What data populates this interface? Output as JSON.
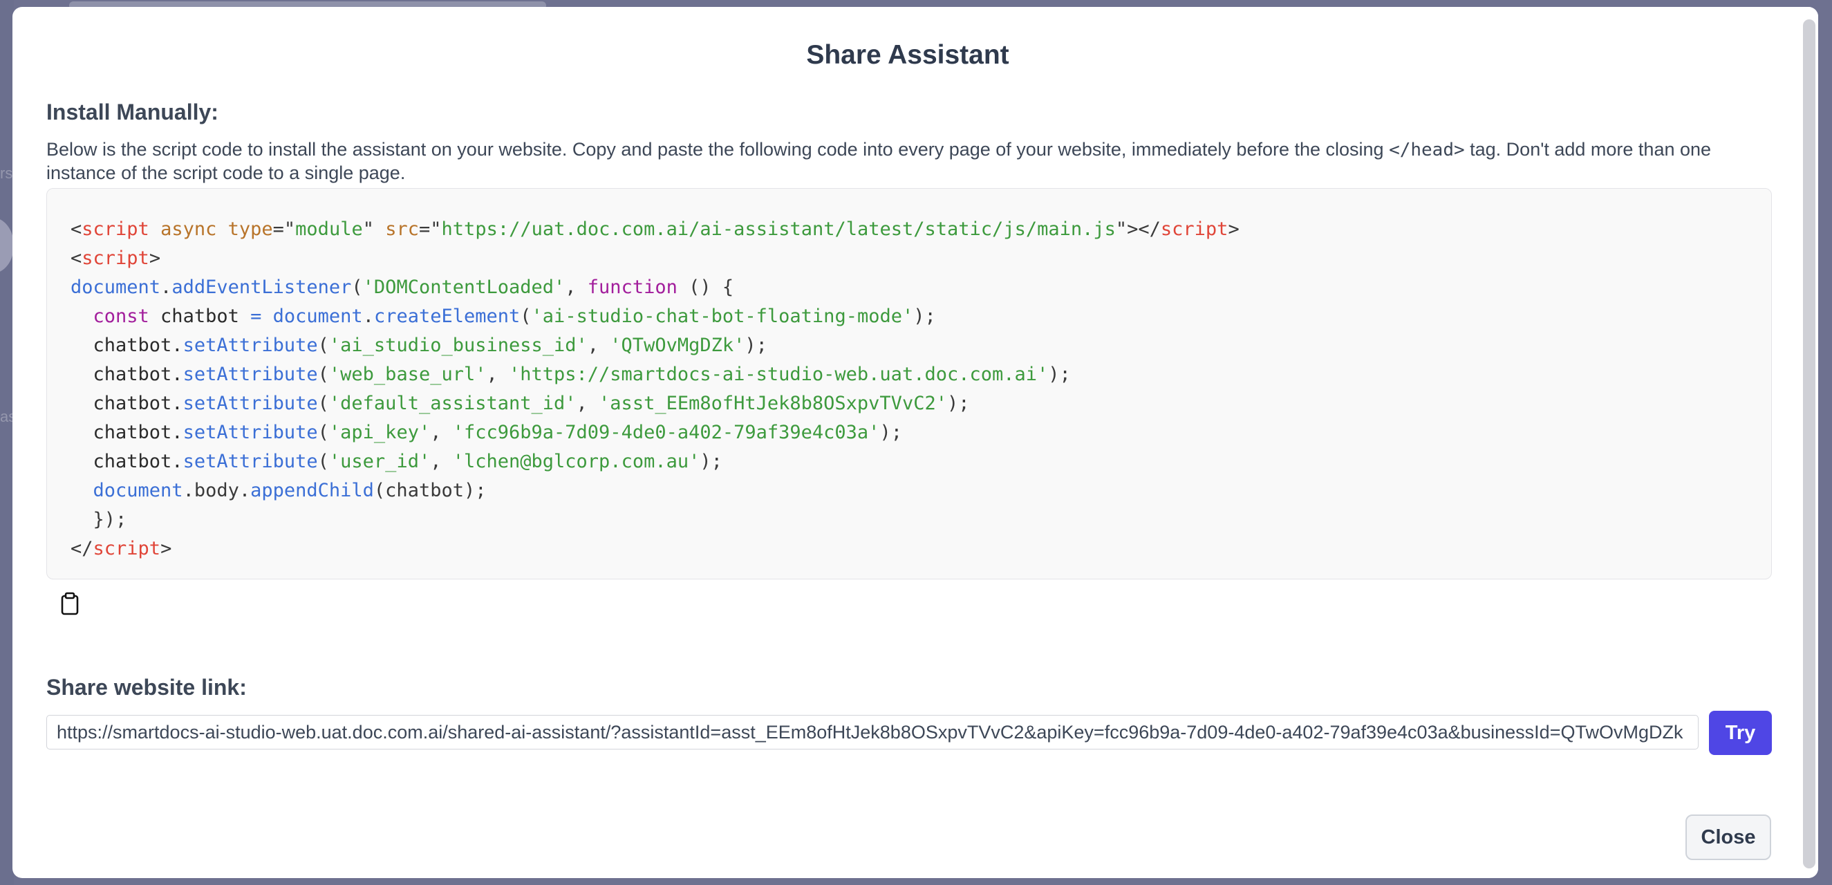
{
  "backdrop": {
    "left_glyph_1": "rs",
    "left_glyph_2": "as"
  },
  "modal": {
    "title": "Share Assistant",
    "install_section": {
      "title": "Install Manually:",
      "description_before": "Below is the script code to install the assistant on your website. Copy and paste the following code into every page of your website, immediately before the closing ",
      "description_tag": "</head>",
      "description_after": " tag. Don't add more than one instance of the script code to a single page."
    },
    "code_lines": [
      [
        [
          "punct",
          "<"
        ],
        [
          "tag",
          "script"
        ],
        [
          "plain",
          " "
        ],
        [
          "attr",
          "async"
        ],
        [
          "plain",
          " "
        ],
        [
          "attr",
          "type"
        ],
        [
          "punct",
          "=\""
        ],
        [
          "str",
          "module"
        ],
        [
          "punct",
          "\""
        ],
        [
          "plain",
          " "
        ],
        [
          "attr",
          "src"
        ],
        [
          "punct",
          "=\""
        ],
        [
          "str",
          "https://uat.doc.com.ai/ai-assistant/latest/static/js/main.js"
        ],
        [
          "punct",
          "\"></"
        ],
        [
          "tag",
          "script"
        ],
        [
          "punct",
          ">"
        ]
      ],
      [
        [
          "punct",
          "<"
        ],
        [
          "tag",
          "script"
        ],
        [
          "punct",
          ">"
        ]
      ],
      [
        [
          "obj",
          "document"
        ],
        [
          "punct",
          "."
        ],
        [
          "fn",
          "addEventListener"
        ],
        [
          "punct",
          "("
        ],
        [
          "str",
          "'DOMContentLoaded'"
        ],
        [
          "punct",
          ", "
        ],
        [
          "kw",
          "function"
        ],
        [
          "punct",
          " () {"
        ]
      ],
      [
        [
          "plain",
          "  "
        ],
        [
          "kw",
          "const"
        ],
        [
          "plain",
          " chatbot "
        ],
        [
          "op",
          "="
        ],
        [
          "plain",
          " "
        ],
        [
          "obj",
          "document"
        ],
        [
          "punct",
          "."
        ],
        [
          "fn",
          "createElement"
        ],
        [
          "punct",
          "("
        ],
        [
          "str",
          "'ai-studio-chat-bot-floating-mode'"
        ],
        [
          "punct",
          ");"
        ]
      ],
      [
        [
          "plain",
          "  chatbot."
        ],
        [
          "fn",
          "setAttribute"
        ],
        [
          "punct",
          "("
        ],
        [
          "str",
          "'ai_studio_business_id'"
        ],
        [
          "punct",
          ", "
        ],
        [
          "str",
          "'QTwOvMgDZk'"
        ],
        [
          "punct",
          ");"
        ]
      ],
      [
        [
          "plain",
          "  chatbot."
        ],
        [
          "fn",
          "setAttribute"
        ],
        [
          "punct",
          "("
        ],
        [
          "str",
          "'web_base_url'"
        ],
        [
          "punct",
          ", "
        ],
        [
          "str",
          "'https://smartdocs-ai-studio-web.uat.doc.com.ai'"
        ],
        [
          "punct",
          ");"
        ]
      ],
      [
        [
          "plain",
          "  chatbot."
        ],
        [
          "fn",
          "setAttribute"
        ],
        [
          "punct",
          "("
        ],
        [
          "str",
          "'default_assistant_id'"
        ],
        [
          "punct",
          ", "
        ],
        [
          "str",
          "'asst_EEm8ofHtJek8b8OSxpvTVvC2'"
        ],
        [
          "punct",
          ");"
        ]
      ],
      [
        [
          "plain",
          "  chatbot."
        ],
        [
          "fn",
          "setAttribute"
        ],
        [
          "punct",
          "("
        ],
        [
          "str",
          "'api_key'"
        ],
        [
          "punct",
          ", "
        ],
        [
          "str",
          "'fcc96b9a-7d09-4de0-a402-79af39e4c03a'"
        ],
        [
          "punct",
          ");"
        ]
      ],
      [
        [
          "plain",
          "  chatbot."
        ],
        [
          "fn",
          "setAttribute"
        ],
        [
          "punct",
          "("
        ],
        [
          "str",
          "'user_id'"
        ],
        [
          "punct",
          ", "
        ],
        [
          "str",
          "'lchen@bglcorp.com.au'"
        ],
        [
          "punct",
          ");"
        ]
      ],
      [
        [
          "plain",
          "  "
        ],
        [
          "obj",
          "document"
        ],
        [
          "punct",
          ".body."
        ],
        [
          "fn",
          "appendChild"
        ],
        [
          "punct",
          "(chatbot);"
        ]
      ],
      [
        [
          "punct",
          "  });"
        ]
      ],
      [
        [
          "punct",
          "</"
        ],
        [
          "tag",
          "script"
        ],
        [
          "punct",
          ">"
        ]
      ]
    ],
    "copy_icon": "clipboard-icon",
    "share_section": {
      "title": "Share website link:",
      "link_value": "https://smartdocs-ai-studio-web.uat.doc.com.ai/shared-ai-assistant/?assistantId=asst_EEm8ofHtJek8b8OSxpvTVvC2&apiKey=fcc96b9a-7d09-4de0-a402-79af39e4c03a&businessId=QTwOvMgDZk",
      "try_label": "Try"
    },
    "close_label": "Close"
  },
  "colors": {
    "backdrop": "#6e7190",
    "primary_button": "#4f46e5",
    "code_tag": "#e04538",
    "code_attr": "#b8742a",
    "code_string": "#3d9a3d",
    "code_function": "#3b6fd6",
    "code_keyword": "#a21e9c"
  }
}
